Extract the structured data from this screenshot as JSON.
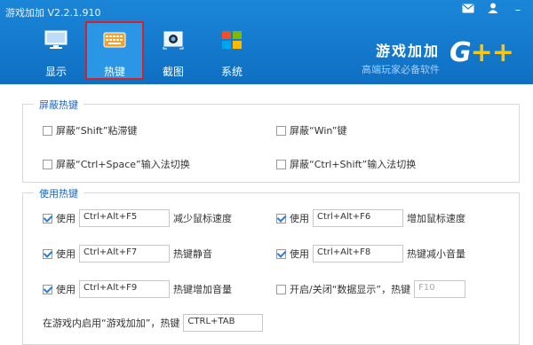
{
  "app": {
    "title": "游戏加加 V2.2.1.910"
  },
  "window_controls": {
    "minimize": "–"
  },
  "tabs": [
    {
      "label": "显示",
      "icon": "monitor-icon",
      "active": false
    },
    {
      "label": "热键",
      "icon": "keyboard-icon",
      "active": true
    },
    {
      "label": "截图",
      "icon": "camera-icon",
      "active": false
    },
    {
      "label": "系统",
      "icon": "windows-icon",
      "active": false
    }
  ],
  "brand": {
    "name": "游戏加加",
    "slogan": "高端玩家必备软件",
    "logo_g": "G",
    "logo_plus": "++"
  },
  "shield_section": {
    "title": "屏蔽热键",
    "items": [
      {
        "label": "屏蔽“Shift”粘滞键",
        "checked": false
      },
      {
        "label": "屏蔽“Win”键",
        "checked": false
      },
      {
        "label": "屏蔽“Ctrl+Space”输入法切换",
        "checked": false
      },
      {
        "label": "屏蔽“Ctrl+Shift”输入法切换",
        "checked": false
      }
    ]
  },
  "use_section": {
    "title": "使用热键",
    "use_label": "使用",
    "items": [
      {
        "checked": true,
        "hotkey": "Ctrl+Alt+F5",
        "desc": "减少鼠标速度"
      },
      {
        "checked": true,
        "hotkey": "Ctrl+Alt+F6",
        "desc": "增加鼠标速度"
      },
      {
        "checked": true,
        "hotkey": "Ctrl+Alt+F7",
        "desc": "热键静音"
      },
      {
        "checked": true,
        "hotkey": "Ctrl+Alt+F8",
        "desc": "热键减小音量"
      },
      {
        "checked": true,
        "hotkey": "Ctrl+Alt+F9",
        "desc": "热键增加音量"
      }
    ],
    "data_display": {
      "checked": false,
      "label": "开启/关闭“数据显示”，热键",
      "hotkey": "F10"
    },
    "enable_in_game": {
      "label": "在游戏内启用“游戏加加”，热键",
      "hotkey": "CTRL+TAB"
    }
  },
  "colors": {
    "header": "#1580d2",
    "active_outline": "#d0232c",
    "section_title": "#2364b8",
    "logo_plus": "#f5c518"
  }
}
